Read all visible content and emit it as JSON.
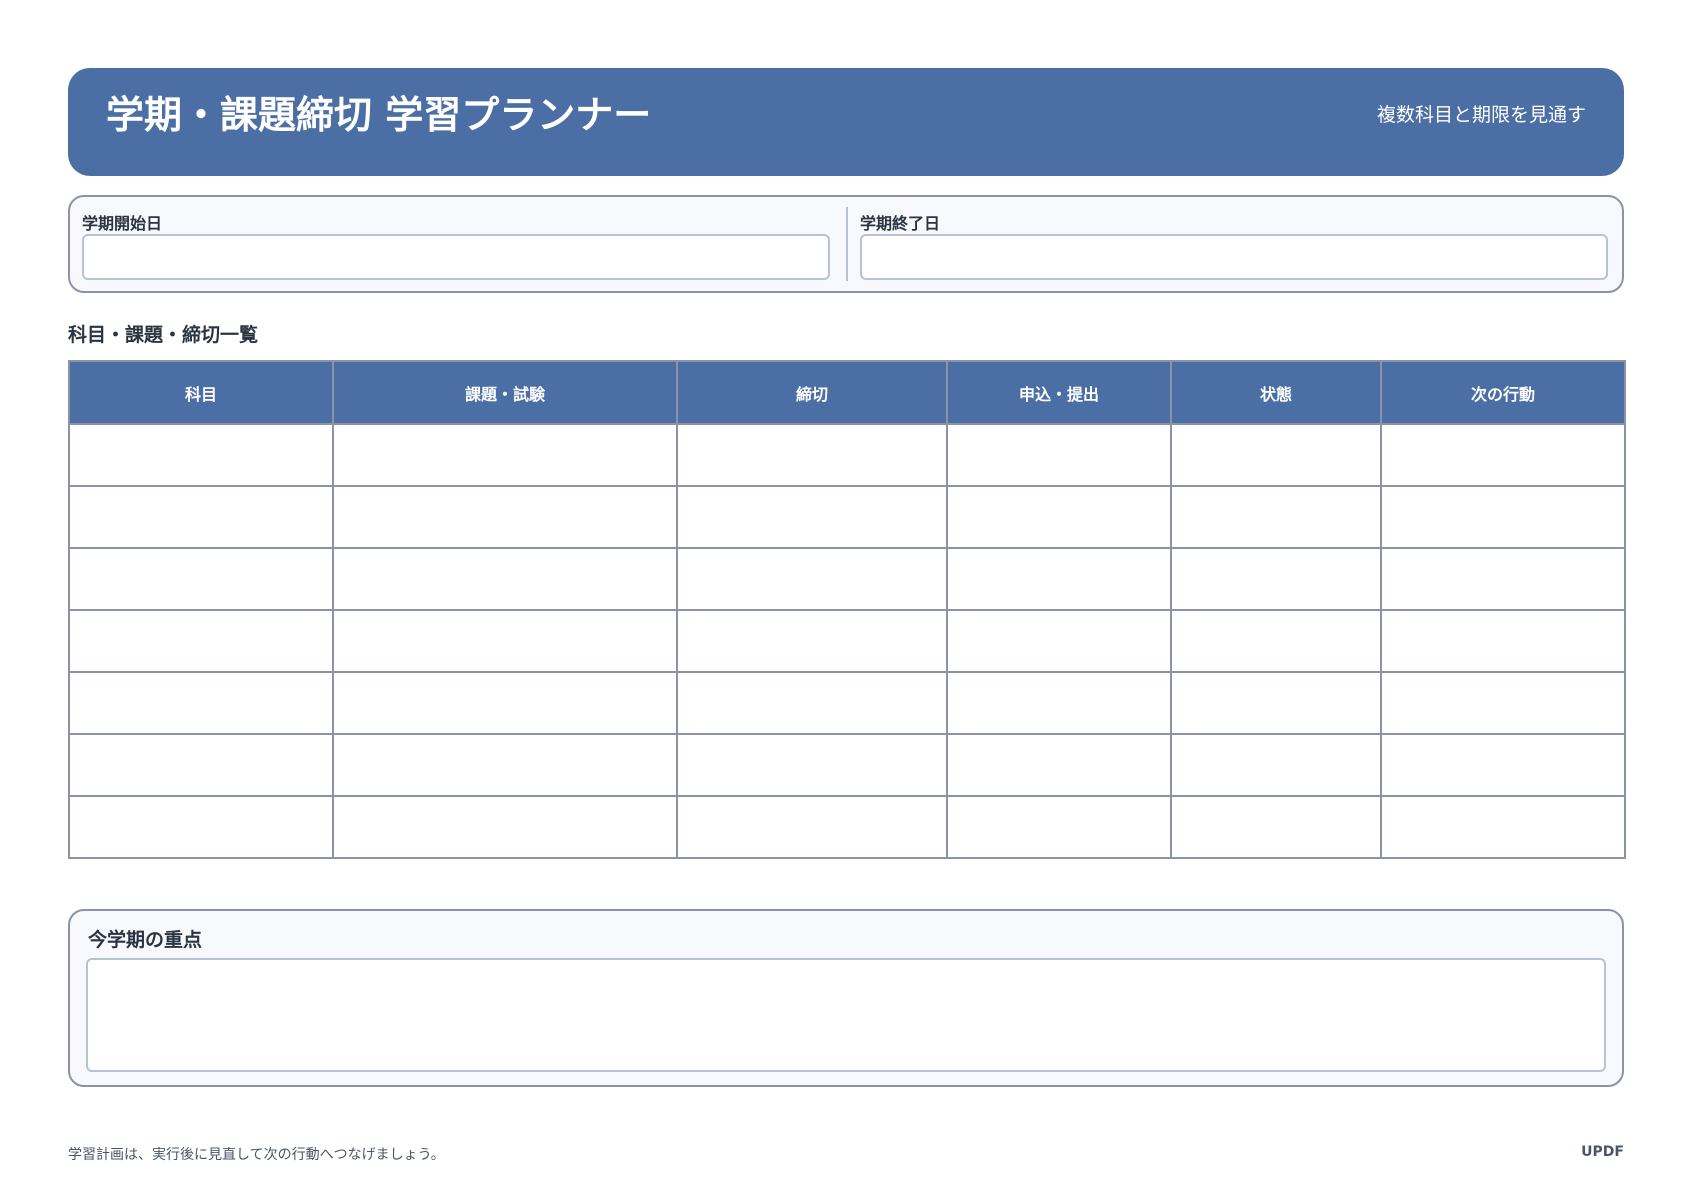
{
  "header": {
    "title": "学期・課題締切 学習プランナー",
    "subtitle": "複数科目と期限を見通す"
  },
  "dates": {
    "start_label": "学期開始日",
    "start_value": "",
    "end_label": "学期終了日",
    "end_value": ""
  },
  "tasks": {
    "section_title": "科目・課題・締切一覧",
    "columns": [
      "科目",
      "課題・試験",
      "締切",
      "申込・提出",
      "状態",
      "次の行動"
    ],
    "rows": [
      [
        "",
        "",
        "",
        "",
        "",
        ""
      ],
      [
        "",
        "",
        "",
        "",
        "",
        ""
      ],
      [
        "",
        "",
        "",
        "",
        "",
        ""
      ],
      [
        "",
        "",
        "",
        "",
        "",
        ""
      ],
      [
        "",
        "",
        "",
        "",
        "",
        ""
      ],
      [
        "",
        "",
        "",
        "",
        "",
        ""
      ],
      [
        "",
        "",
        "",
        "",
        "",
        ""
      ]
    ]
  },
  "focus": {
    "label": "今学期の重点",
    "value": ""
  },
  "footer": {
    "note": "学習計画は、実行後に見直して次の行動へつなげましょう。",
    "brand": "UPDF"
  },
  "colors": {
    "accent": "#4b6fa5",
    "border": "#8a94a6",
    "input_border": "#b7c2d6",
    "panel_bg": "#f7f9fc",
    "text": "#2b3442"
  }
}
